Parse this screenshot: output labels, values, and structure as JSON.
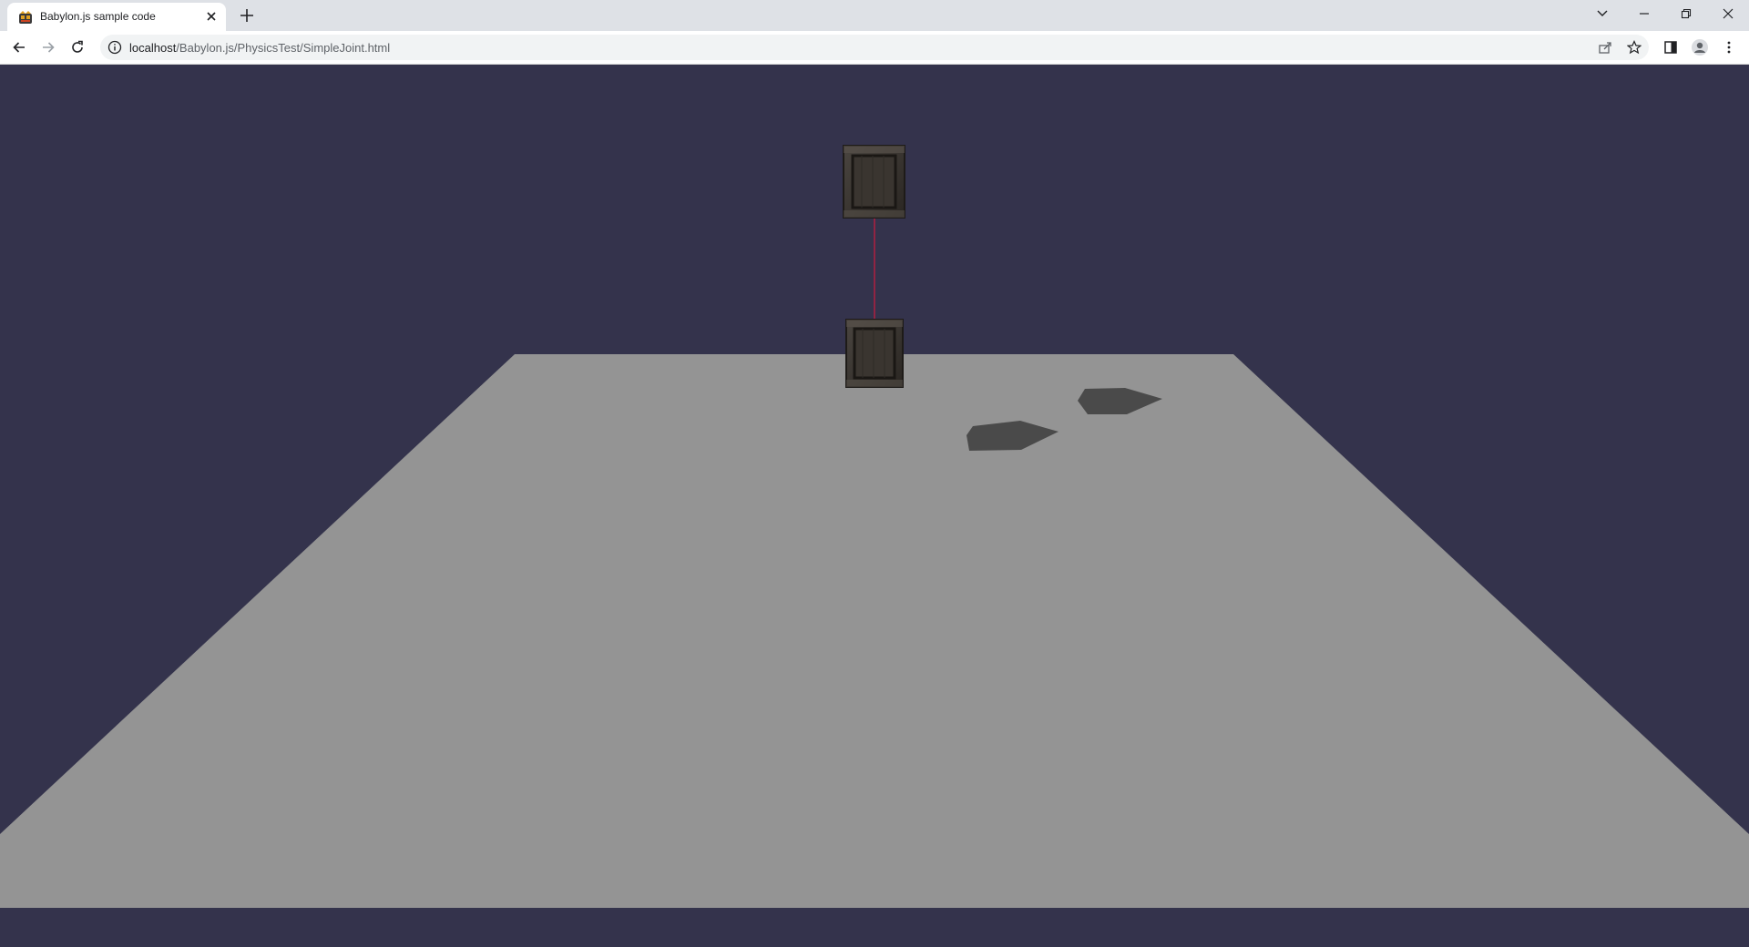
{
  "browser": {
    "tab": {
      "title": "Babylon.js sample code",
      "favicon": "babylon-logo-icon"
    },
    "address_bar": {
      "host": "localhost",
      "path": "/Babylon.js/PhysicsTest/SimpleJoint.html"
    },
    "icons": {
      "back": "arrow-left-icon",
      "forward": "arrow-right-icon",
      "reload": "reload-icon",
      "site_info": "info-icon",
      "share": "share-icon",
      "bookmark": "star-icon",
      "side_panel": "side-panel-icon",
      "profile": "profile-icon",
      "menu": "kebab-menu-icon"
    }
  },
  "scene": {
    "background_color": "#34334c",
    "ground_color": "#949494",
    "shadow_color": "#4a4a4a",
    "joint_color": "#b02040",
    "objects": [
      "crate-top",
      "crate-bottom",
      "joint-line",
      "ground-plane",
      "shadow-1",
      "shadow-2"
    ]
  }
}
